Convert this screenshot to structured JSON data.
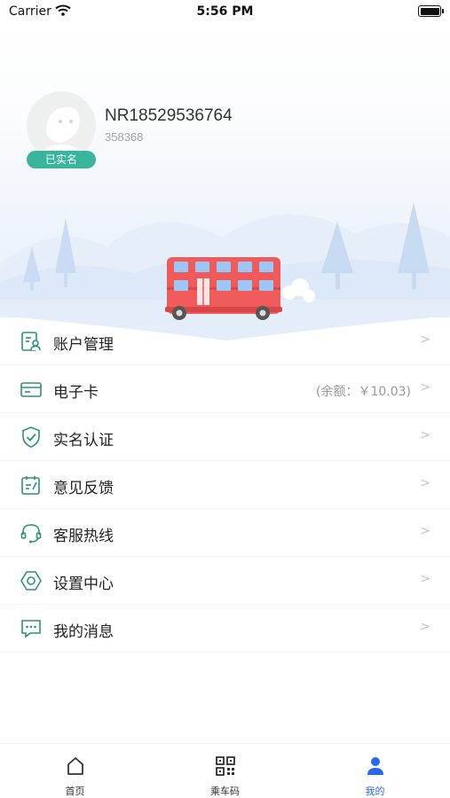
{
  "status_bar": {
    "carrier": "Carrier",
    "time": "5:56 PM"
  },
  "profile": {
    "username": "NR18529536764",
    "user_id": "358368",
    "verified_badge": "已实名"
  },
  "menu": {
    "items": [
      {
        "label": "账户管理",
        "icon": "account-icon",
        "arrow": ">"
      },
      {
        "label": "电子卡",
        "icon": "card-icon",
        "extra": "(余额：￥10.03)",
        "arrow": ">"
      },
      {
        "label": "实名认证",
        "icon": "shield-check-icon",
        "arrow": ">"
      },
      {
        "label": "意见反馈",
        "icon": "feedback-icon",
        "arrow": ">"
      },
      {
        "label": "客服热线",
        "icon": "headset-icon",
        "arrow": ">"
      },
      {
        "label": "设置中心",
        "icon": "settings-icon",
        "arrow": ">"
      },
      {
        "label": "我的消息",
        "icon": "message-icon",
        "arrow": ">"
      }
    ]
  },
  "tab_bar": {
    "tabs": [
      {
        "label": "首页",
        "icon": "home-icon"
      },
      {
        "label": "乘车码",
        "icon": "qr-code-icon"
      },
      {
        "label": "我的",
        "icon": "user-icon",
        "active": true
      }
    ]
  },
  "colors": {
    "accent": "#2968e8",
    "verified": "#39b49d",
    "icon_teal": "#2f8f7f",
    "bus_red": "#ef5a5a"
  }
}
